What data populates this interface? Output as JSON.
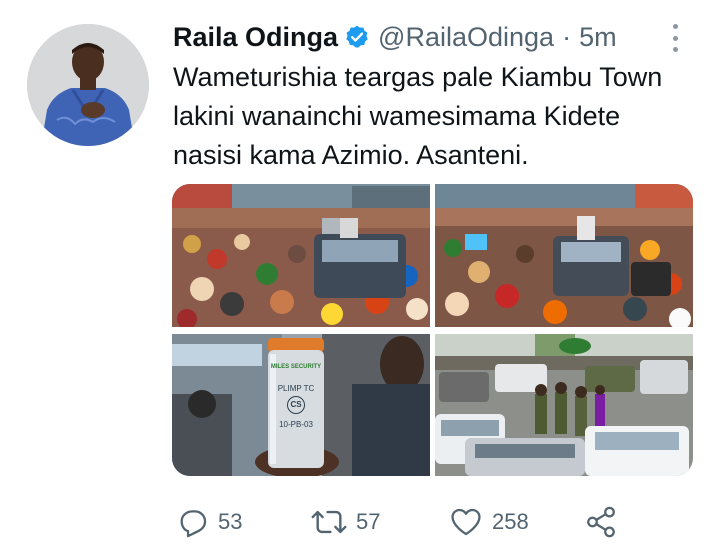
{
  "tweet": {
    "author_name": "Raila Odinga",
    "handle": "@RailaOdinga",
    "separator": "·",
    "time": "5m",
    "text_lines": [
      "Wameturishia teargas pale Kiambu Town",
      "lakini wanainchi wamesimama Kidete",
      "nasisi kama Azimio. Asanteni."
    ],
    "canister_label": {
      "brand": "MILES SECURITY",
      "model": "PLIMP TC",
      "code": "CS",
      "batch": "10-PB-03"
    },
    "stats": {
      "replies": "53",
      "retweets": "57",
      "likes": "258"
    }
  },
  "colors": {
    "text_primary": "#0f1419",
    "text_secondary": "#536471",
    "verified_blue": "#1d9bf0",
    "more_dots": "#8b98a5",
    "avatar_shirt": "#3f63b5"
  },
  "icons": {
    "verified": "verified-badge-icon",
    "more": "more-options-icon",
    "reply": "reply-icon",
    "retweet": "retweet-icon",
    "like": "heart-icon",
    "share": "share-icon"
  }
}
